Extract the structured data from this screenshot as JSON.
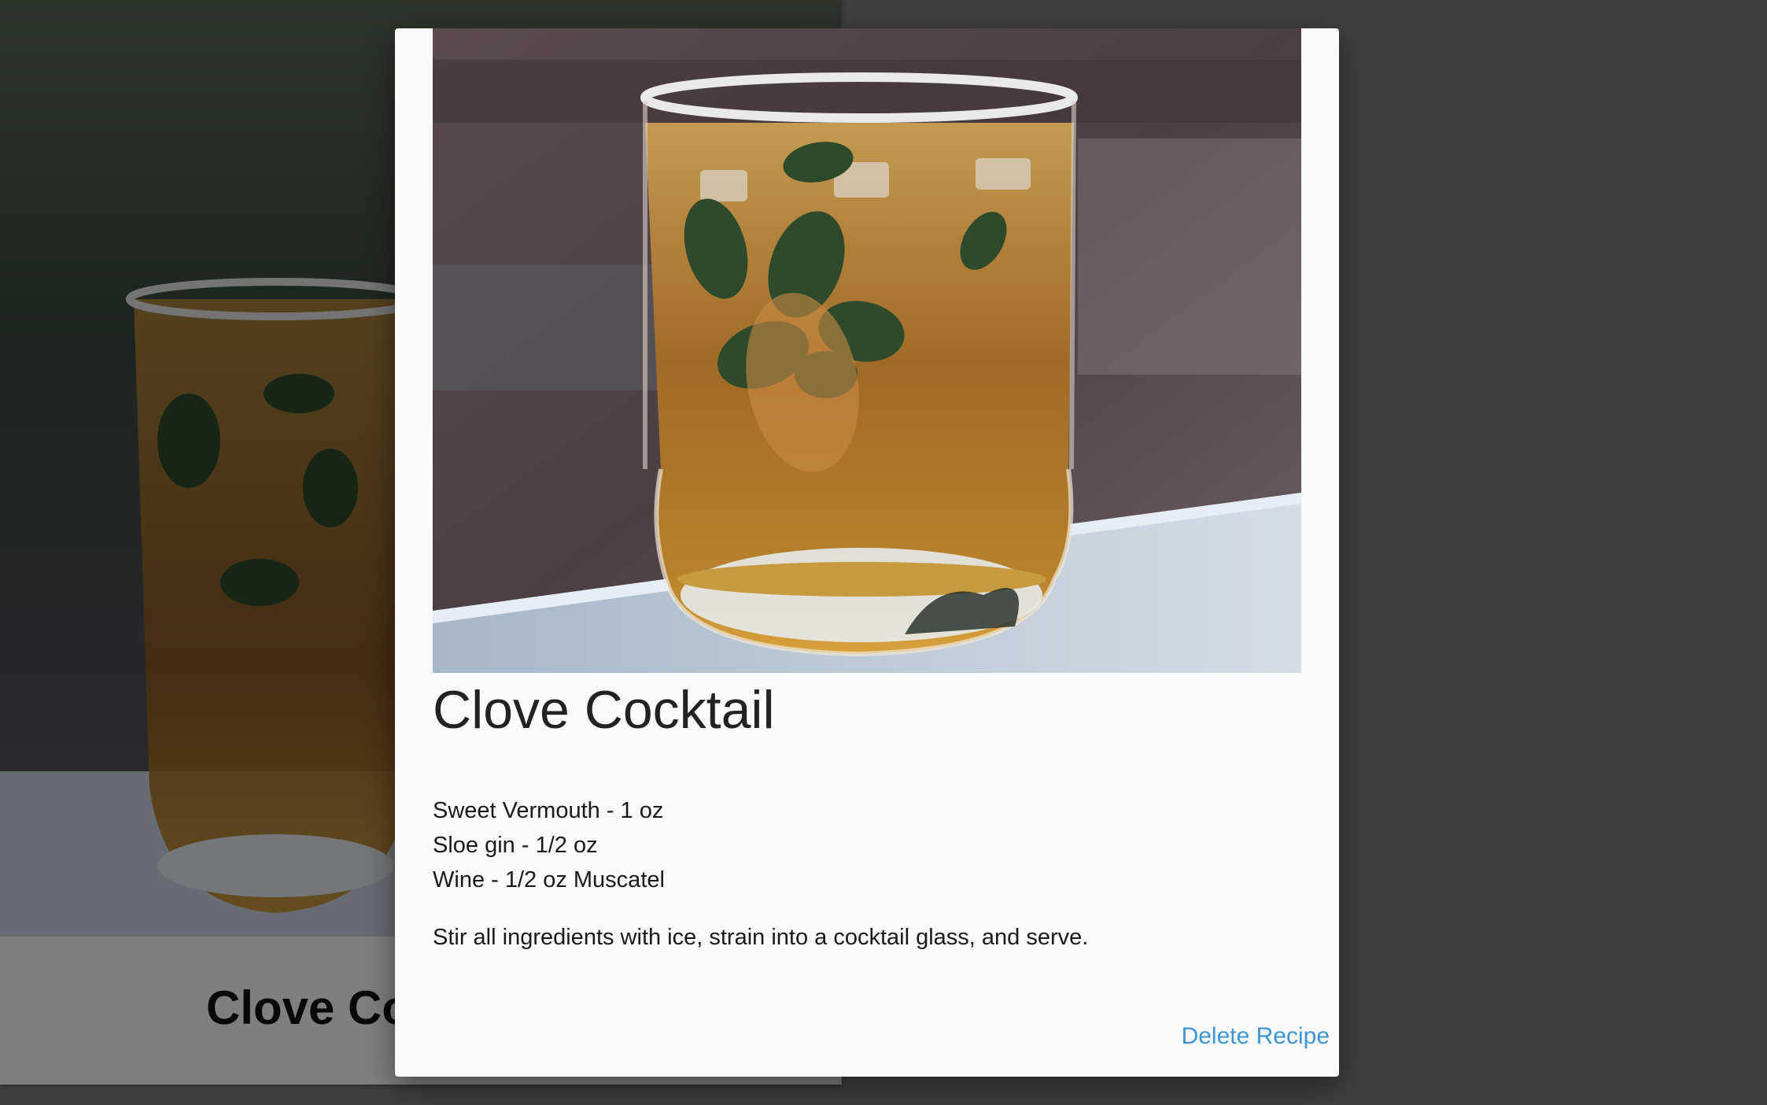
{
  "background_card": {
    "title": "Clove Cocktail",
    "photo_icon": "cocktail-glass-photo"
  },
  "modal": {
    "photo_icon": "cocktail-glass-photo",
    "title": "Clove Cocktail",
    "ingredients": [
      "Sweet Vermouth - 1 oz",
      "Sloe gin - 1/2 oz",
      "Wine - 1/2 oz Muscatel"
    ],
    "instructions": "Stir all ingredients with ice, strain into a cocktail glass, and serve.",
    "delete_label": "Delete Recipe"
  },
  "colors": {
    "link": "#3d95d6",
    "overlay": "rgba(0,0,0,0.5)",
    "modal_bg": "#fafafa"
  }
}
